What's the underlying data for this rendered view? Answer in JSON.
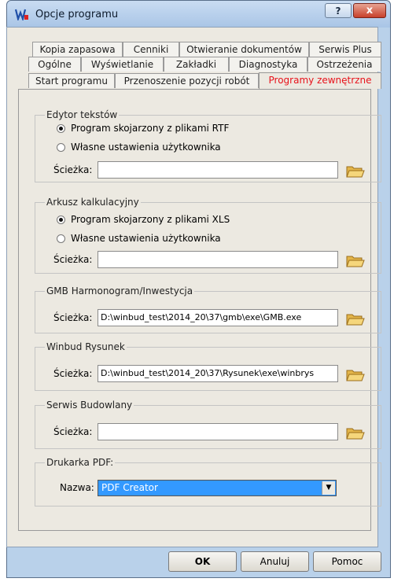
{
  "window": {
    "title": "Opcje programu",
    "help_label": "?",
    "close_label": "x"
  },
  "tabs": [
    {
      "label": "Kopia zapasowa"
    },
    {
      "label": "Cenniki"
    },
    {
      "label": "Otwieranie dokumentów"
    },
    {
      "label": "Serwis Plus"
    },
    {
      "label": "Ogólne"
    },
    {
      "label": "Wyświetlanie"
    },
    {
      "label": "Zakładki"
    },
    {
      "label": "Diagnostyka"
    },
    {
      "label": "Ostrzeżenia"
    },
    {
      "label": "Start programu"
    },
    {
      "label": "Przenoszenie pozycji robót"
    },
    {
      "label": "Programy zewnętrzne"
    }
  ],
  "active_tab": "Programy zewnętrzne",
  "text_editor": {
    "title": "Edytor tekstów",
    "option1": "Program skojarzony z plikami RTF",
    "option2": "Własne ustawienia użytkownika",
    "path_label": "Ścieżka:",
    "path_value": ""
  },
  "spreadsheet": {
    "title": "Arkusz kalkulacyjny",
    "option1": "Program skojarzony z plikami XLS",
    "option2": "Własne ustawienia użytkownika",
    "path_label": "Ścieżka:",
    "path_value": ""
  },
  "gmb": {
    "title": "GMB Harmonogram/Inwestycja",
    "path_label": "Ścieżka:",
    "path_value": "D:\\winbud_test\\2014_20\\37\\gmb\\exe\\GMB.exe"
  },
  "winbud_drawing": {
    "title": "Winbud Rysunek",
    "path_label": "Ścieżka:",
    "path_value": "D:\\winbud_test\\2014_20\\37\\Rysunek\\exe\\winbrys"
  },
  "construction_service": {
    "title": "Serwis Budowlany",
    "path_label": "Ścieżka:",
    "path_value": ""
  },
  "pdf_printer": {
    "title": "Drukarka PDF:",
    "name_label": "Nazwa:",
    "selected": "PDF Creator"
  },
  "buttons": {
    "ok": "OK",
    "cancel": "Anuluj",
    "help": "Pomoc"
  },
  "colors": {
    "active_tab": "#e8121b",
    "selection": "#3399ff",
    "title_bar": "#b9d1ea",
    "close": "#c7402b"
  }
}
